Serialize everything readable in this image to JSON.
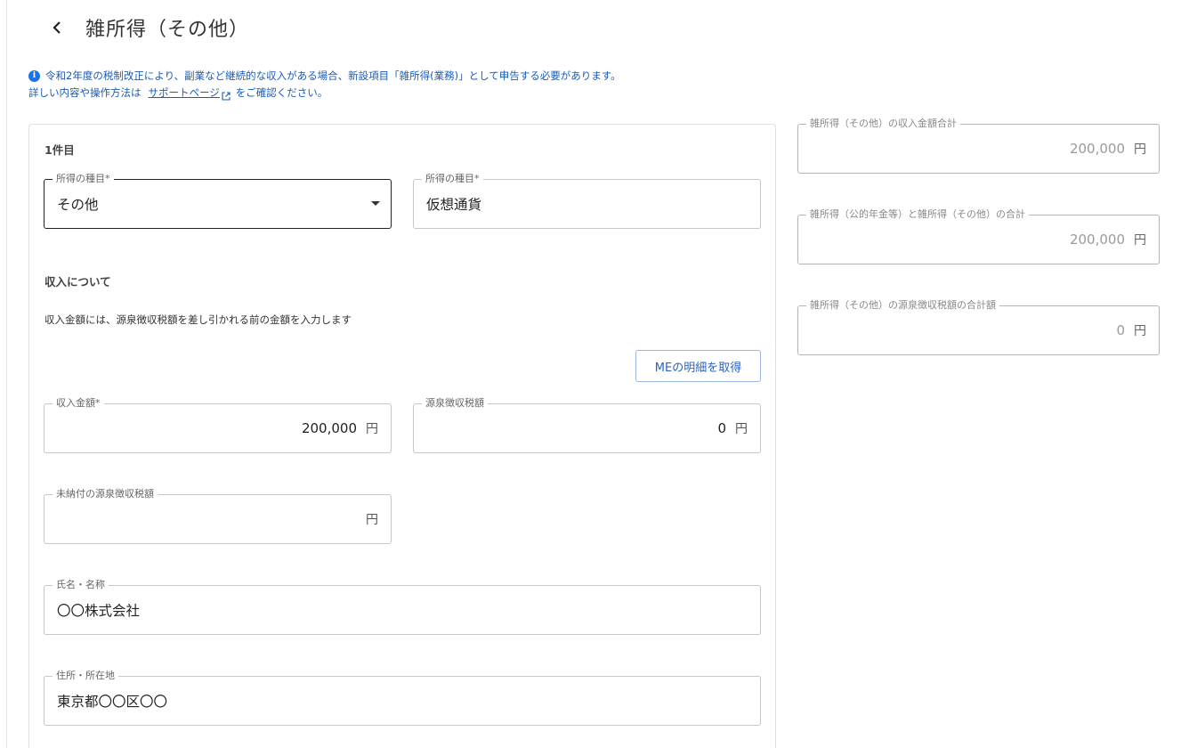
{
  "header": {
    "title": "雑所得（その他）"
  },
  "notice": {
    "line1": "令和2年度の税制改正により、副業など継続的な収入がある場合、新設項目「雑所得(業務)」として申告する必要があります。",
    "line2_prefix": "詳しい内容や操作方法は",
    "link_label": "サポートページ",
    "line2_suffix": "をご確認ください。"
  },
  "card": {
    "title": "1件目",
    "income_type_select": {
      "label": "所得の種目*",
      "value": "その他"
    },
    "income_kind_input": {
      "label": "所得の種目*",
      "value": "仮想通貨"
    },
    "section_title": "収入について",
    "section_desc": "収入金額には、源泉徴収税額を差し引かれる前の金額を入力します",
    "me_button_label": "MEの明細を取得",
    "revenue": {
      "label": "収入金額*",
      "value": "200,000",
      "unit": "円"
    },
    "withholding": {
      "label": "源泉徴収税額",
      "value": "0",
      "unit": "円"
    },
    "unpaid_withholding": {
      "label": "未納付の源泉徴収税額",
      "value": "",
      "unit": "円"
    },
    "payer_name": {
      "label": "氏名・名称",
      "value": "〇〇株式会社"
    },
    "payer_address": {
      "label": "住所・所在地",
      "value": "東京都〇〇区〇〇"
    }
  },
  "summary": {
    "other_total": {
      "label": "雑所得（その他）の収入金額合計",
      "value": "200,000",
      "unit": "円"
    },
    "combined_total": {
      "label": "雑所得（公的年金等）と雑所得（その他）の合計",
      "value": "200,000",
      "unit": "円"
    },
    "withholding_total": {
      "label": "雑所得（その他）の源泉徴収税額の合計額",
      "value": "0",
      "unit": "円"
    }
  },
  "colors": {
    "accent": "#1a73e8",
    "link": "#1a5bb8",
    "border": "#c7c7c7"
  },
  "icons": {
    "back": "chevron-left-icon",
    "info": "info-icon",
    "external": "external-link-icon",
    "dropdown": "caret-down-icon"
  }
}
